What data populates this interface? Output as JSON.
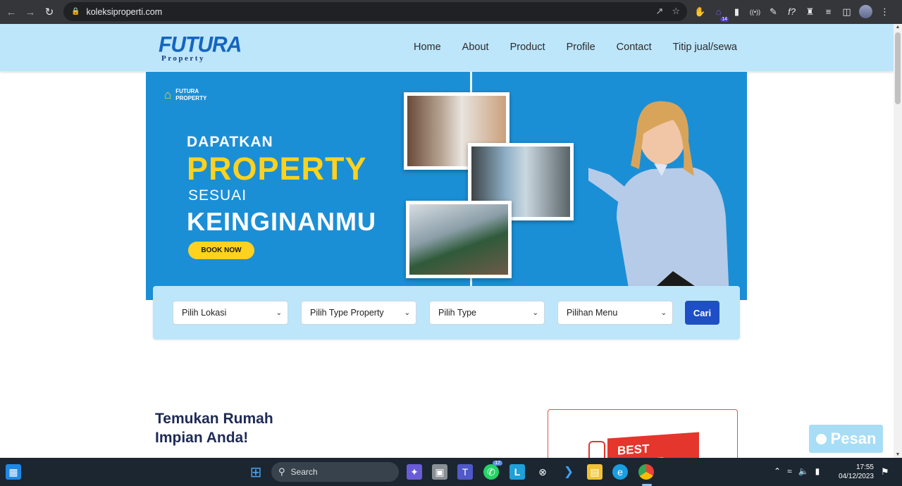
{
  "browser": {
    "url": "koleksiproperti.com",
    "icons": [
      "back-icon",
      "forward-icon",
      "reload-icon",
      "lock-icon",
      "share-icon",
      "star-icon"
    ],
    "extension_badge": "14"
  },
  "site": {
    "logo_main": "FUTURA",
    "logo_sub": "Property",
    "menu": [
      {
        "label": "Home"
      },
      {
        "label": "About"
      },
      {
        "label": "Product"
      },
      {
        "label": "Profile"
      },
      {
        "label": "Contact"
      },
      {
        "label": "Titip jual/sewa"
      }
    ]
  },
  "hero": {
    "brand_line1": "FUTURA",
    "brand_line2": "PROPERTY",
    "line1": "DAPATKAN",
    "line2": "PROPERTY",
    "line3": "SESUAI",
    "line4": "KEINGINANMU",
    "cta": "BOOK NOW",
    "background": "#1b8fd6",
    "accent": "#ffd21f"
  },
  "search": {
    "selects": [
      {
        "value": "Pilih Lokasi"
      },
      {
        "value": "Pilih Type Property"
      },
      {
        "value": "Pilih Type"
      },
      {
        "value": "Pilihan Menu"
      }
    ],
    "button": "Cari",
    "button_color": "#1f4fc6"
  },
  "content": {
    "headline_line1": "Temukan Rumah",
    "headline_line2": "Impian Anda!",
    "card_ribbon": "BEST CHOICE"
  },
  "chat": {
    "label": "Pesan"
  },
  "taskbar": {
    "search_placeholder": "Search",
    "whatsapp_badge": "17",
    "time": "17:55",
    "date": "04/12/2023"
  }
}
